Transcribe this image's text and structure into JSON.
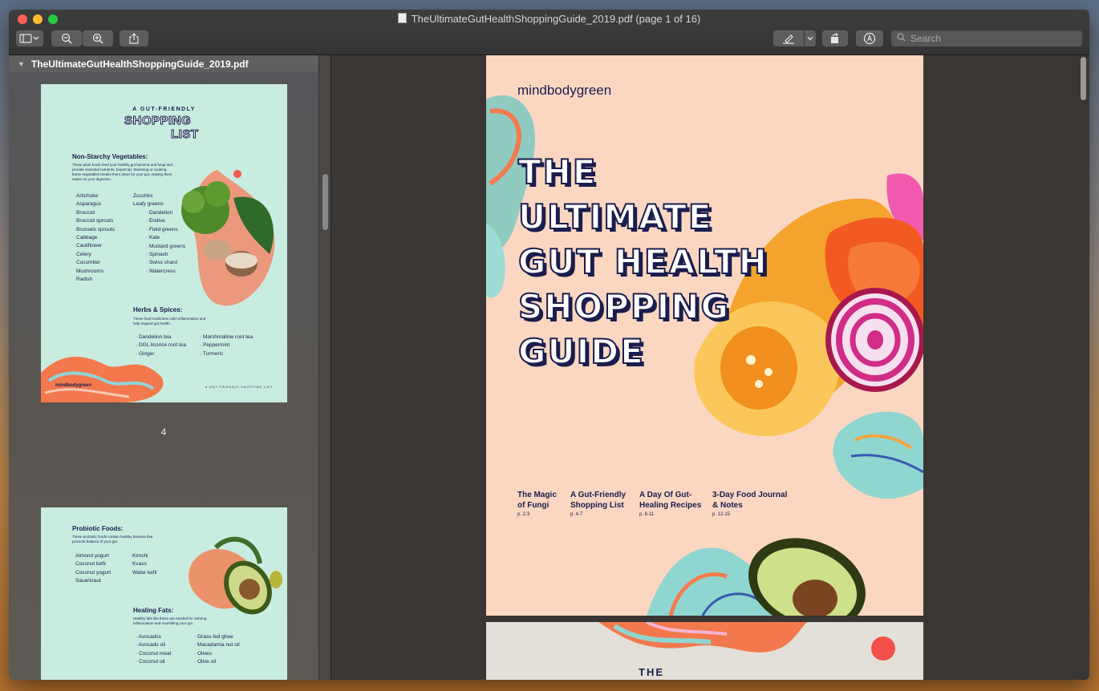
{
  "window": {
    "title": "TheUltimateGutHealthShoppingGuide_2019.pdf (page 1 of 16)"
  },
  "toolbar": {
    "search_placeholder": "Search"
  },
  "sidebar": {
    "filename": "TheUltimateGutHealthShoppingGuide_2019.pdf",
    "page_label": "4",
    "thumb1": {
      "kicker": "A GUT-FRIENDLY",
      "title_line1": "SHOPPING",
      "title_line2": "LIST",
      "section1_heading": "Non-Starchy Vegetables:",
      "section1_desc": "These plant foods feed your healthy gut bacteria and fungi and provide essential nutrients. Expert tip: Steaming or cooking these vegetables breaks them down for your gut, making them easier on your digestion.",
      "col1": [
        "Artichoke",
        "Asparagus",
        "Broccoli",
        "Broccoli sprouts",
        "Brussels sprouts",
        "Cabbage",
        "Cauliflower",
        "Celery",
        "Cucumber",
        "Mushrooms",
        "Radish"
      ],
      "col2_top": [
        "Zucchini",
        "Leafy greens"
      ],
      "col2_sub": [
        "Dandelion",
        "Endive",
        "Field greens",
        "Kale",
        "Mustard greens",
        "Spinach",
        "Swiss chard",
        "Watercress"
      ],
      "section2_heading": "Herbs & Spices:",
      "section2_desc": "These food medicines calm inflammation and help support gut health.",
      "herbs_col1": [
        "Dandelion tea",
        "DGL licorice root tea",
        "Ginger"
      ],
      "herbs_col2": [
        "Marshmallow root tea",
        "Peppermint",
        "Turmeric"
      ],
      "logo": "mindbodygreen",
      "footer": "A GUT-FRIENDLY SHOPPING LIST"
    },
    "thumb2": {
      "section1_heading": "Probiotic Foods:",
      "section1_desc": "These probiotic foods contain healthy bacteria that promote balance in your gut.",
      "col1": [
        "Almond yogurt",
        "Coconut kefir",
        "Coconut yogurt",
        "Sauerkraut"
      ],
      "col2": [
        "Kimchi",
        "Kvass",
        "Water kefir"
      ],
      "section2_heading": "Healing Fats:",
      "section2_desc": "Healthy fats like these are needed for calming inflammation and nourishing your gut.",
      "fats_col1": [
        "Avocados",
        "Avocado oil",
        "Coconut meat",
        "Coconut oil"
      ],
      "fats_col2": [
        "Grass-fed ghee",
        "Macadamia nut oil",
        "Olives",
        "Olive oil"
      ]
    }
  },
  "cover": {
    "logo": "mindbodygreen",
    "title_lines": [
      "THE",
      "ULTIMATE",
      "GUT HEALTH",
      "SHOPPING",
      "GUIDE"
    ],
    "toc": [
      {
        "line1": "The Magic",
        "line2": "of Fungi",
        "pages": "p. 2-3"
      },
      {
        "line1": "A Gut-Friendly",
        "line2": "Shopping List",
        "pages": "p. 4-7"
      },
      {
        "line1": "A Day Of Gut-",
        "line2": "Healing Recipes",
        "pages": "p. 8-11"
      },
      {
        "line1": "3-Day Food Journal",
        "line2": "& Notes",
        "pages": "p. 12-15"
      }
    ]
  },
  "page2": {
    "text": "THE"
  }
}
